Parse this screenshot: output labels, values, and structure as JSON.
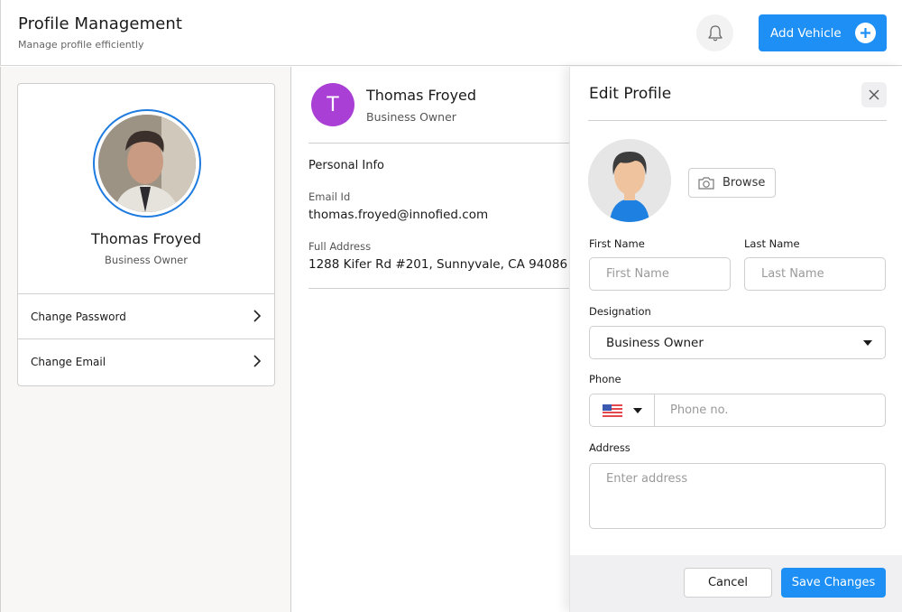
{
  "header": {
    "title": "Profile Management",
    "subtitle": "Manage profile efficiently",
    "notification_icon": "bell-icon",
    "add_vehicle_label": "Add Vehicle",
    "add_vehicle_icon": "plus-circle-icon",
    "accent_color": "#1e90f5"
  },
  "profile_card": {
    "name": "Thomas Froyed",
    "role": "Business Owner",
    "links": [
      {
        "label": "Change Password",
        "icon": "chevron-right-icon"
      },
      {
        "label": "Change Email",
        "icon": "chevron-right-icon"
      }
    ]
  },
  "details": {
    "avatar_initial": "T",
    "avatar_color": "#a93fd4",
    "name": "Thomas Froyed",
    "role": "Business Owner",
    "section_title": "Personal Info",
    "email_label": "Email Id",
    "email_value": "thomas.froyed@innofied.com",
    "address_label": "Full Address",
    "address_value": "1288 Kifer Rd #201, Sunnyvale, CA 94086"
  },
  "edit_profile": {
    "title": "Edit Profile",
    "close_icon": "close-icon",
    "browse_label": "Browse",
    "browse_icon": "camera-icon",
    "first_name": {
      "label": "First Name",
      "placeholder": "First Name",
      "value": ""
    },
    "last_name": {
      "label": "Last Name",
      "placeholder": "Last Name",
      "value": ""
    },
    "designation": {
      "label": "Designation",
      "selected": "Business Owner"
    },
    "phone": {
      "label": "Phone",
      "country_flag": "us-flag-icon",
      "placeholder": "Phone no.",
      "value": ""
    },
    "address": {
      "label": "Address",
      "placeholder": "Enter address",
      "value": ""
    },
    "cancel_label": "Cancel",
    "save_label": "Save Changes"
  }
}
